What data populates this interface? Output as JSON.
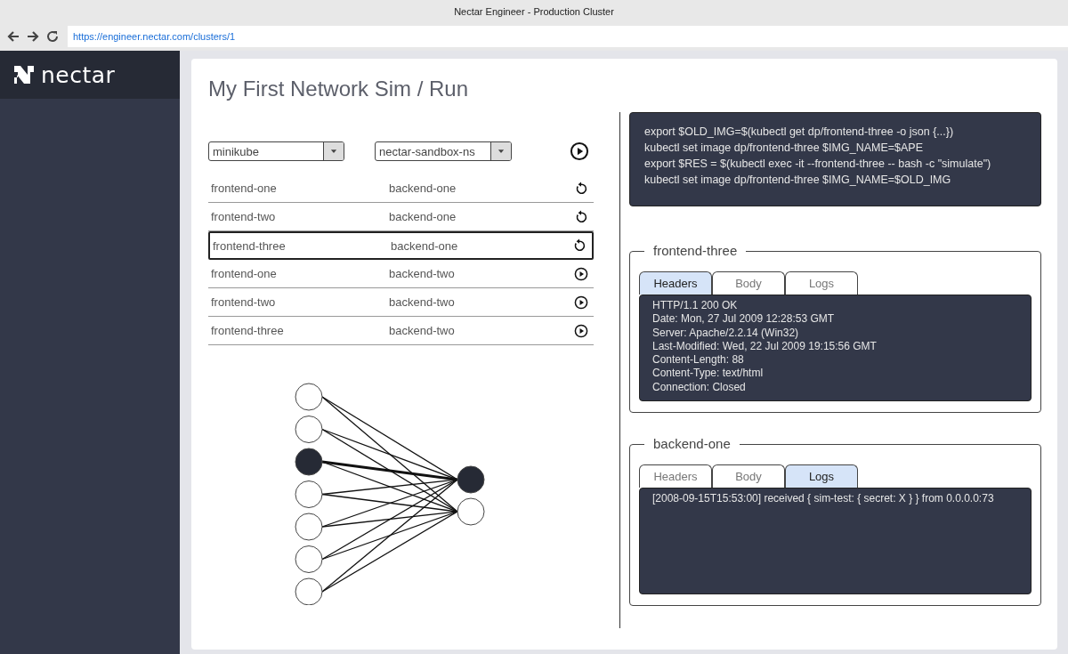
{
  "window": {
    "title": "Nectar Engineer - Production Cluster"
  },
  "address_bar": {
    "url": "https://engineer.nectar.com/clusters/1"
  },
  "sidebar": {
    "logo": "nectar"
  },
  "page_title": "My First Network Sim / Run",
  "selects": [
    {
      "value": "minikube"
    },
    {
      "value": "nectar-sandbox-ns"
    }
  ],
  "runs": [
    {
      "frontend": "frontend-one",
      "backend": "backend-one",
      "kind": "restart",
      "selected": false
    },
    {
      "frontend": "frontend-two",
      "backend": "backend-one",
      "kind": "restart",
      "selected": false
    },
    {
      "frontend": "frontend-three",
      "backend": "backend-one",
      "kind": "restart",
      "selected": true
    },
    {
      "frontend": "frontend-one",
      "backend": "backend-two",
      "kind": "play",
      "selected": false
    },
    {
      "frontend": "frontend-two",
      "backend": "backend-two",
      "kind": "play",
      "selected": false
    },
    {
      "frontend": "frontend-three",
      "backend": "backend-two",
      "kind": "play",
      "selected": false
    }
  ],
  "network": {
    "inputs": [
      {
        "active": false
      },
      {
        "active": false
      },
      {
        "active": true
      },
      {
        "active": false
      },
      {
        "active": false
      },
      {
        "active": false
      },
      {
        "active": false
      }
    ],
    "outputs": [
      {
        "active": true
      },
      {
        "active": false
      }
    ]
  },
  "script_lines": [
    "export $OLD_IMG=$(kubectl get dp/frontend-three -o json {...})",
    "kubectl set image dp/frontend-three $IMG_NAME=$APE",
    "export $RES = $(kubectl exec -it --frontend-three -- bash -c \"simulate\")",
    "kubectl set image dp/frontend-three $IMG_NAME=$OLD_IMG"
  ],
  "panels": [
    {
      "legend": "frontend-three",
      "tabs": [
        {
          "label": "Headers",
          "selected": true
        },
        {
          "label": "Body",
          "selected": false
        },
        {
          "label": "Logs",
          "selected": false
        }
      ],
      "lines": [
        "HTTP/1.1 200 OK",
        "Date: Mon, 27 Jul 2009 12:28:53 GMT",
        "Server: Apache/2.2.14 (Win32)",
        "Last-Modified: Wed, 22 Jul 2009 19:15:56 GMT",
        "Content-Length: 88",
        "Content-Type: text/html",
        "Connection: Closed"
      ]
    },
    {
      "legend": "backend-one",
      "tabs": [
        {
          "label": "Headers",
          "selected": false
        },
        {
          "label": "Body",
          "selected": false
        },
        {
          "label": "Logs",
          "selected": true
        }
      ],
      "lines": [
        "[2008-09-15T15:53:00] received { sim-test: { secret: X } } from 0.0.0.0:73"
      ]
    }
  ]
}
